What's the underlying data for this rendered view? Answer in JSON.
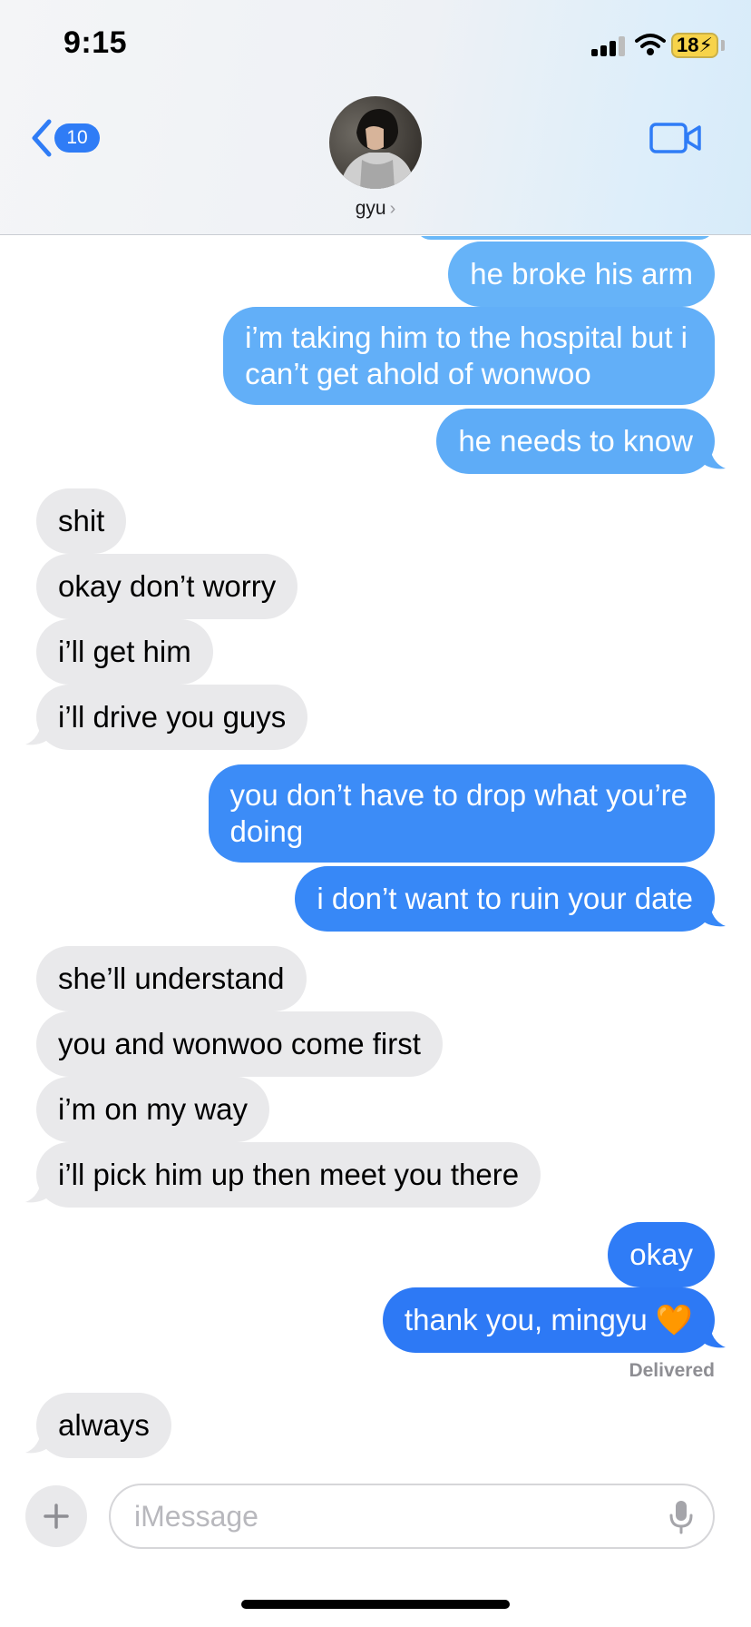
{
  "status_bar": {
    "time": "9:15",
    "battery": "18",
    "icons": [
      "cellular-signal-icon",
      "wifi-icon",
      "battery-charging-icon"
    ]
  },
  "header": {
    "back_badge": "10",
    "contact_name": "gyu",
    "icons": [
      "back-chevron-icon",
      "video-call-icon",
      "contact-chevron-icon"
    ]
  },
  "messages": [
    {
      "from": "me",
      "text": "he broke his arm"
    },
    {
      "from": "me",
      "text": "i’m taking him to the hospital but i\ncan’t get ahold of wonwoo"
    },
    {
      "from": "me",
      "text": "he needs to know"
    },
    {
      "from": "them",
      "text": "shit"
    },
    {
      "from": "them",
      "text": "okay don’t worry"
    },
    {
      "from": "them",
      "text": "i’ll get him"
    },
    {
      "from": "them",
      "text": "i’ll drive you guys"
    },
    {
      "from": "me",
      "text": "you don’t have to drop what you’re\ndoing"
    },
    {
      "from": "me",
      "text": "i don’t want to ruin your date"
    },
    {
      "from": "them",
      "text": "she’ll understand"
    },
    {
      "from": "them",
      "text": "you and wonwoo come first"
    },
    {
      "from": "them",
      "text": "i’m on my way"
    },
    {
      "from": "them",
      "text": "i’ll pick him up then meet you there"
    },
    {
      "from": "me",
      "text": "okay"
    },
    {
      "from": "me",
      "text": "thank you, mingyu 🧡"
    },
    {
      "from": "them",
      "text": "always"
    }
  ],
  "delivered_label": "Delivered",
  "composer": {
    "placeholder": "iMessage",
    "icons": [
      "plus-icon",
      "microphone-icon"
    ]
  },
  "colors": {
    "sent_top": "#5fb0f7",
    "sent_bottom": "#2f7cf6",
    "received": "#e9e9eb",
    "accent": "#2f7cf6"
  }
}
